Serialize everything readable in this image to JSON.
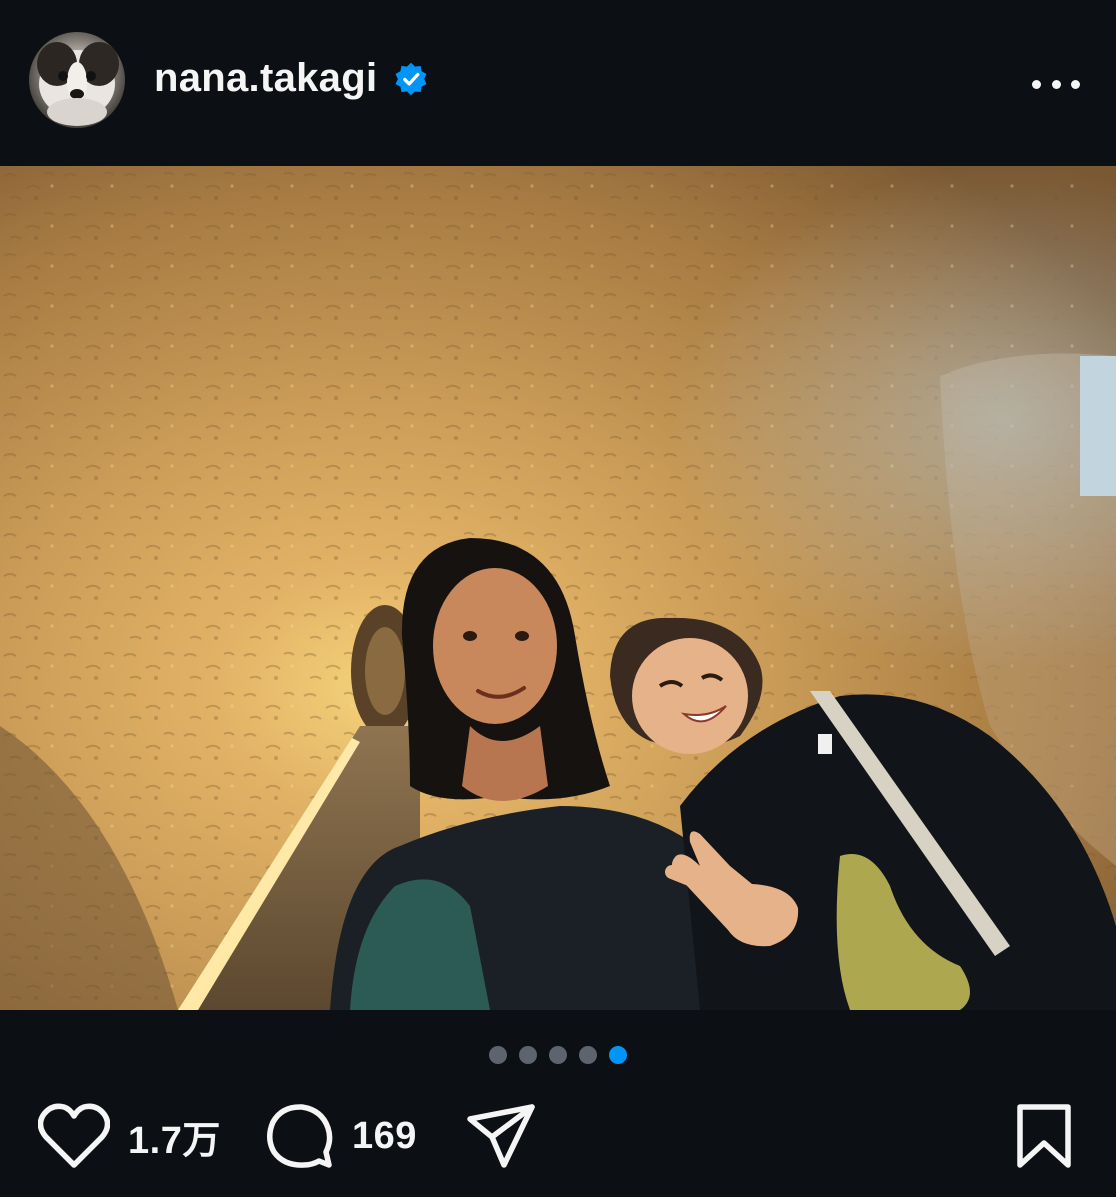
{
  "post": {
    "username": "nana.takagi",
    "verified": true,
    "avatar_icon": "dog-avatar-icon",
    "more_icon": "more-options-icon"
  },
  "carousel": {
    "total": 5,
    "active_index": 5
  },
  "actions": {
    "likes_count": "1.7万",
    "comments_count": "169",
    "like_icon": "heart-icon",
    "comment_icon": "comment-icon",
    "share_icon": "send-icon",
    "save_icon": "bookmark-icon"
  },
  "colors": {
    "background": "#0c1014",
    "text": "#f5f5f5",
    "accent_blue": "#0095f6",
    "inactive_dot": "#5d646d"
  }
}
